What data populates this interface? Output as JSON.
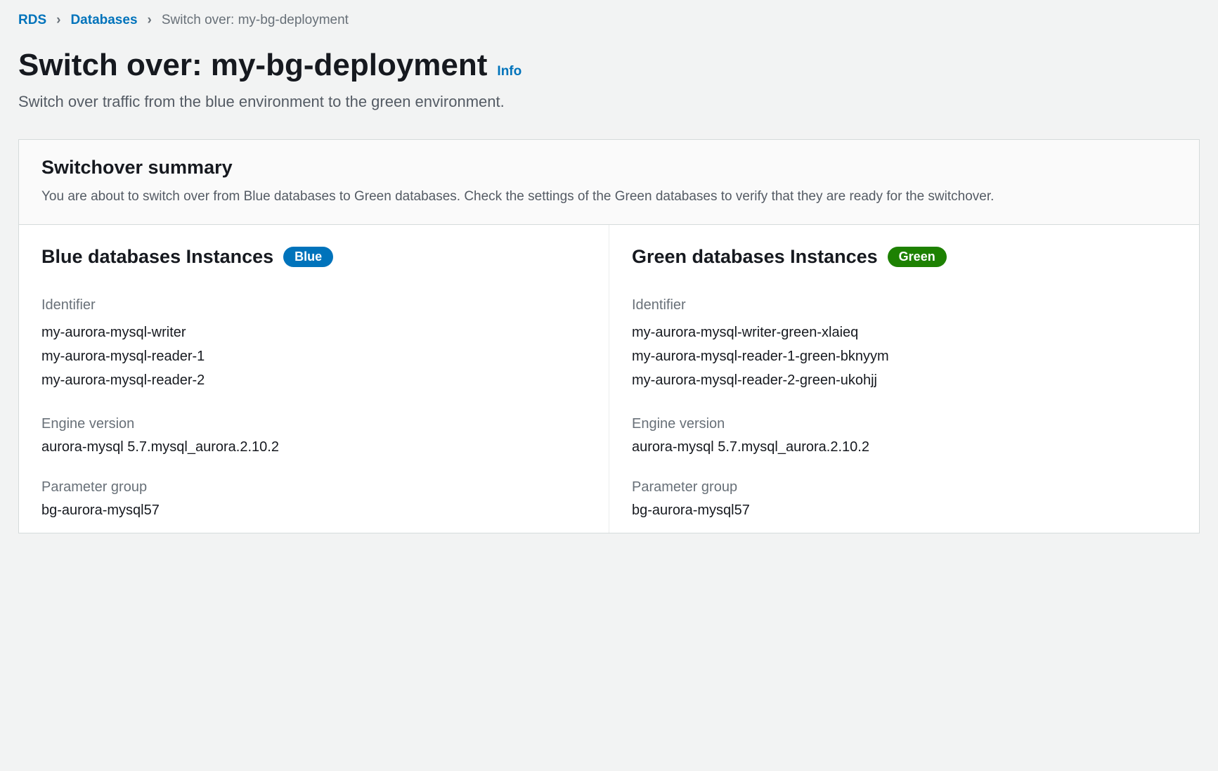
{
  "breadcrumb": {
    "root": "RDS",
    "databases": "Databases",
    "current": "Switch over: my-bg-deployment"
  },
  "header": {
    "title": "Switch over: my-bg-deployment",
    "info": "Info",
    "subtitle": "Switch over traffic from the blue environment to the green environment."
  },
  "summary": {
    "title": "Switchover summary",
    "text": "You are about to switch over from Blue databases to Green databases. Check the settings of the Green databases to verify that they are ready for the switchover."
  },
  "labels": {
    "identifier": "Identifier",
    "engine": "Engine version",
    "param_group": "Parameter group"
  },
  "blue": {
    "title": "Blue databases Instances",
    "badge": "Blue",
    "identifiers": [
      "my-aurora-mysql-writer",
      "my-aurora-mysql-reader-1",
      "my-aurora-mysql-reader-2"
    ],
    "engine": "aurora-mysql 5.7.mysql_aurora.2.10.2",
    "param_group": "bg-aurora-mysql57"
  },
  "green": {
    "title": "Green databases Instances",
    "badge": "Green",
    "identifiers": [
      "my-aurora-mysql-writer-green-xlaieq",
      "my-aurora-mysql-reader-1-green-bknyym",
      "my-aurora-mysql-reader-2-green-ukohjj"
    ],
    "engine": "aurora-mysql 5.7.mysql_aurora.2.10.2",
    "param_group": "bg-aurora-mysql57"
  }
}
